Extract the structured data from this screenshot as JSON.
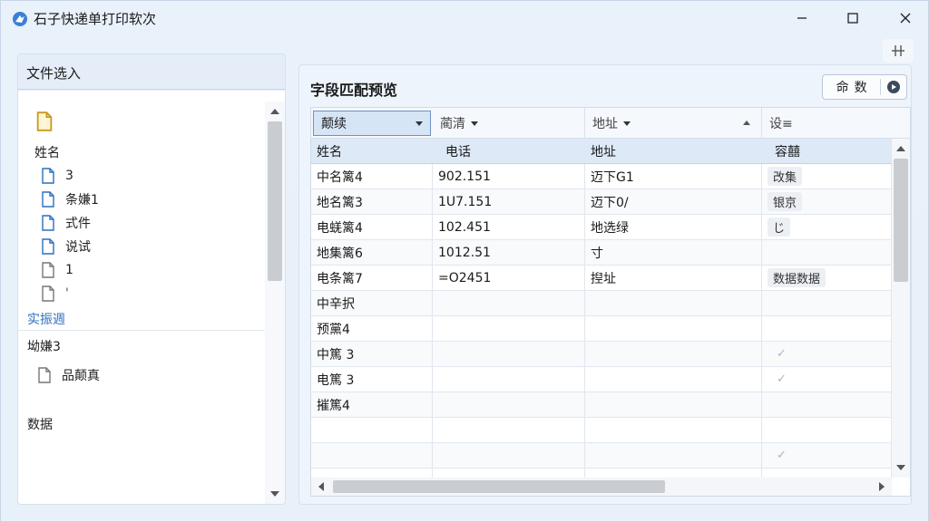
{
  "window": {
    "title": "石子快递单打印软次"
  },
  "left": {
    "tab_label": "文件选入",
    "group1_label": "姓名",
    "items": [
      {
        "label": "3",
        "icon": "file-icon"
      },
      {
        "label": "条嫌1",
        "icon": "file-icon"
      },
      {
        "label": "式件",
        "icon": "file-icon"
      },
      {
        "label": "说试",
        "icon": "file-icon"
      },
      {
        "label": "1",
        "icon": "file-icon"
      },
      {
        "label": "'",
        "icon": "file-icon"
      }
    ],
    "link_label": "实振週",
    "group2_label": "坳嫌3",
    "group2_item": "品颠真",
    "group3_label": "数据"
  },
  "right": {
    "section_title": "字段匹配预览",
    "button_label": "命数",
    "header": [
      "颠续",
      "蔺清",
      "地址",
      "设≡"
    ],
    "subheader": [
      "姓名",
      "电话",
      "地址",
      "容囍"
    ],
    "rows": [
      [
        "中名篱4",
        "902.151",
        "迈下G1",
        "改集"
      ],
      [
        "地名篱3",
        "1U7.151",
        "迈下0/",
        "银京"
      ],
      [
        "电蜣篱4",
        "102.451",
        "地选绿",
        "じ"
      ],
      [
        "地集篱6",
        "1012.51",
        "寸",
        ""
      ],
      [
        "电条篱7",
        "=O2451",
        "揑址",
        "数据数据"
      ],
      [
        "中辛択",
        "",
        "",
        ""
      ],
      [
        "预黨4",
        "",
        "",
        ""
      ],
      [
        "中篤 3",
        "",
        "",
        "✓"
      ],
      [
        "电篤 3",
        "",
        "",
        "✓"
      ],
      [
        "摧篤4",
        "",
        "",
        ""
      ],
      [
        "",
        "",
        "",
        ""
      ],
      [
        "",
        "",
        "",
        "✓"
      ],
      [
        "",
        "",
        "",
        ""
      ]
    ]
  },
  "colors": {
    "accent": "#2c6fbf",
    "header_bg": "#dde9f6",
    "select_bg": "#d6e5f6"
  }
}
